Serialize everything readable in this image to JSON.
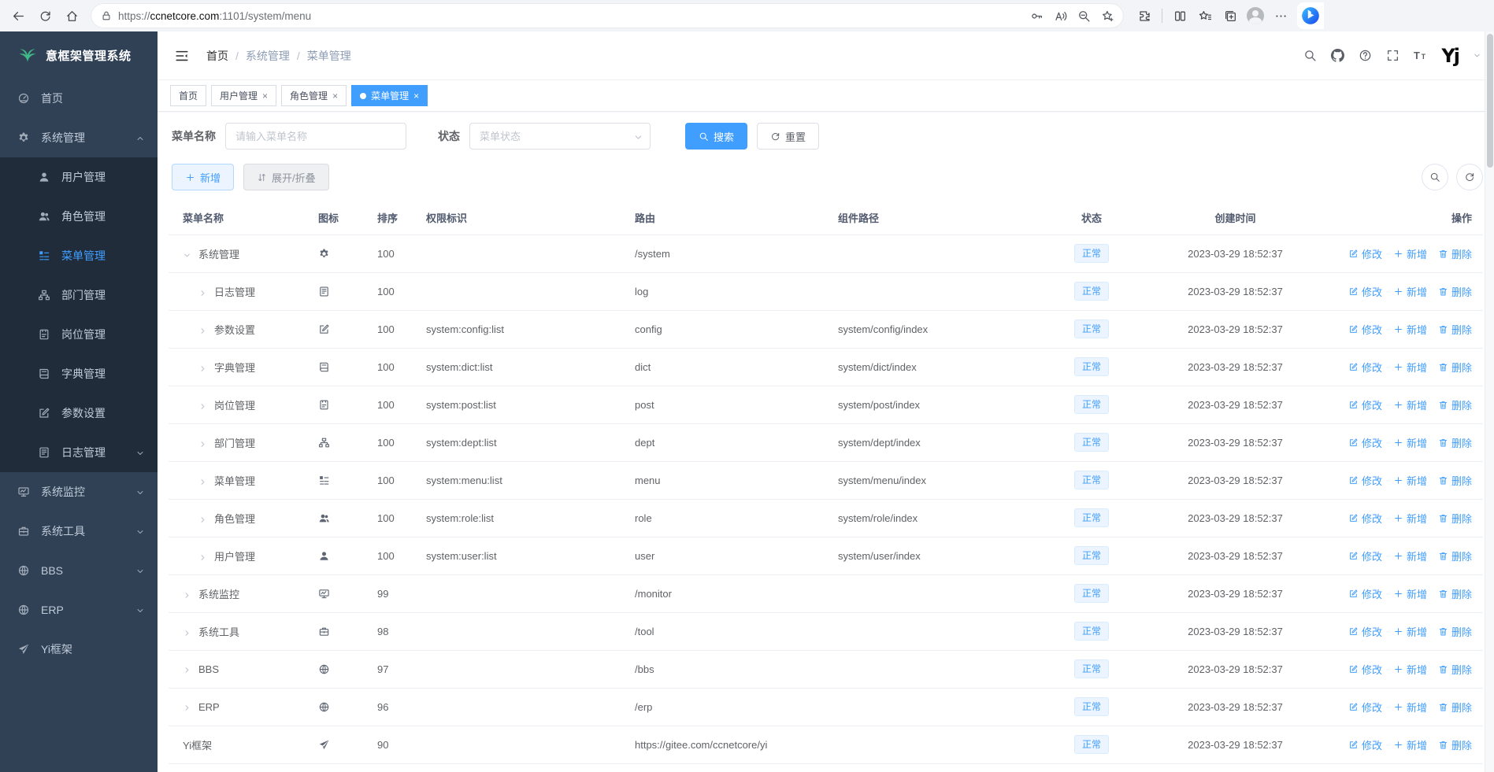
{
  "browser": {
    "url": {
      "scheme": "https://",
      "host": "ccnetcore.com",
      "path": ":1101/system/menu"
    }
  },
  "sidebar": {
    "logo_text": "意框架管理系统",
    "items": [
      {
        "label": "首页",
        "icon": "gauge-icon"
      },
      {
        "label": "系统管理",
        "icon": "gear-icon",
        "chevron": "up",
        "open": true
      },
      {
        "label": "系统监控",
        "icon": "monitor-icon",
        "chevron": "down"
      },
      {
        "label": "系统工具",
        "icon": "toolbox-icon",
        "chevron": "down"
      },
      {
        "label": "BBS",
        "icon": "globe-icon",
        "chevron": "down"
      },
      {
        "label": "ERP",
        "icon": "globe-icon",
        "chevron": "down"
      },
      {
        "label": "Yi框架",
        "icon": "send-icon"
      }
    ],
    "submenu": [
      {
        "label": "用户管理",
        "icon": "user-icon"
      },
      {
        "label": "角色管理",
        "icon": "users-icon"
      },
      {
        "label": "菜单管理",
        "icon": "menu-icon",
        "active": true
      },
      {
        "label": "部门管理",
        "icon": "tree-icon"
      },
      {
        "label": "岗位管理",
        "icon": "badge-icon"
      },
      {
        "label": "字典管理",
        "icon": "book-icon"
      },
      {
        "label": "参数设置",
        "icon": "edit-square-icon"
      },
      {
        "label": "日志管理",
        "icon": "log-icon",
        "chevron": "down"
      }
    ]
  },
  "header": {
    "breadcrumb": [
      "首页",
      "系统管理",
      "菜单管理"
    ],
    "separator": "/"
  },
  "tabs": [
    {
      "label": "首页"
    },
    {
      "label": "用户管理",
      "closable": true
    },
    {
      "label": "角色管理",
      "closable": true
    },
    {
      "label": "菜单管理",
      "closable": true,
      "active": true
    }
  ],
  "filters": {
    "name_label": "菜单名称",
    "name_placeholder": "请输入菜单名称",
    "status_label": "状态",
    "status_placeholder": "菜单状态",
    "search_label": "搜索",
    "reset_label": "重置"
  },
  "toolbar": {
    "add_label": "新增",
    "toggle_label": "展开/折叠"
  },
  "table": {
    "columns": [
      "菜单名称",
      "图标",
      "排序",
      "权限标识",
      "路由",
      "组件路径",
      "状态",
      "创建时间",
      "操作"
    ],
    "actions": {
      "edit": "修改",
      "add": "新增",
      "delete": "删除"
    },
    "rows": [
      {
        "name": "系统管理",
        "icon": "gear-icon",
        "arrow": "down",
        "child": false,
        "sort": "100",
        "perm": "",
        "route": "/system",
        "component": "",
        "status": "正常",
        "created": "2023-03-29 18:52:37"
      },
      {
        "name": "日志管理",
        "icon": "log-icon",
        "arrow": "right",
        "child": true,
        "sort": "100",
        "perm": "",
        "route": "log",
        "component": "",
        "status": "正常",
        "created": "2023-03-29 18:52:37"
      },
      {
        "name": "参数设置",
        "icon": "edit-square-icon",
        "arrow": "right",
        "child": true,
        "sort": "100",
        "perm": "system:config:list",
        "route": "config",
        "component": "system/config/index",
        "status": "正常",
        "created": "2023-03-29 18:52:37"
      },
      {
        "name": "字典管理",
        "icon": "book-icon",
        "arrow": "right",
        "child": true,
        "sort": "100",
        "perm": "system:dict:list",
        "route": "dict",
        "component": "system/dict/index",
        "status": "正常",
        "created": "2023-03-29 18:52:37"
      },
      {
        "name": "岗位管理",
        "icon": "badge-icon",
        "arrow": "right",
        "child": true,
        "sort": "100",
        "perm": "system:post:list",
        "route": "post",
        "component": "system/post/index",
        "status": "正常",
        "created": "2023-03-29 18:52:37"
      },
      {
        "name": "部门管理",
        "icon": "tree-icon",
        "arrow": "right",
        "child": true,
        "sort": "100",
        "perm": "system:dept:list",
        "route": "dept",
        "component": "system/dept/index",
        "status": "正常",
        "created": "2023-03-29 18:52:37"
      },
      {
        "name": "菜单管理",
        "icon": "menu-icon",
        "arrow": "right",
        "child": true,
        "sort": "100",
        "perm": "system:menu:list",
        "route": "menu",
        "component": "system/menu/index",
        "status": "正常",
        "created": "2023-03-29 18:52:37"
      },
      {
        "name": "角色管理",
        "icon": "users-icon",
        "arrow": "right",
        "child": true,
        "sort": "100",
        "perm": "system:role:list",
        "route": "role",
        "component": "system/role/index",
        "status": "正常",
        "created": "2023-03-29 18:52:37"
      },
      {
        "name": "用户管理",
        "icon": "user-icon",
        "arrow": "right",
        "child": true,
        "sort": "100",
        "perm": "system:user:list",
        "route": "user",
        "component": "system/user/index",
        "status": "正常",
        "created": "2023-03-29 18:52:37"
      },
      {
        "name": "系统监控",
        "icon": "monitor-icon",
        "arrow": "right",
        "child": false,
        "sort": "99",
        "perm": "",
        "route": "/monitor",
        "component": "",
        "status": "正常",
        "created": "2023-03-29 18:52:37"
      },
      {
        "name": "系统工具",
        "icon": "toolbox-icon",
        "arrow": "right",
        "child": false,
        "sort": "98",
        "perm": "",
        "route": "/tool",
        "component": "",
        "status": "正常",
        "created": "2023-03-29 18:52:37"
      },
      {
        "name": "BBS",
        "icon": "globe-icon",
        "arrow": "right",
        "child": false,
        "sort": "97",
        "perm": "",
        "route": "/bbs",
        "component": "",
        "status": "正常",
        "created": "2023-03-29 18:52:37"
      },
      {
        "name": "ERP",
        "icon": "globe-icon",
        "arrow": "right",
        "child": false,
        "sort": "96",
        "perm": "",
        "route": "/erp",
        "component": "",
        "status": "正常",
        "created": "2023-03-29 18:52:37"
      },
      {
        "name": "Yi框架",
        "icon": "send-icon",
        "arrow": null,
        "child": false,
        "sort": "90",
        "perm": "",
        "route": "https://gitee.com/ccnetcore/yi",
        "component": "",
        "status": "正常",
        "created": "2023-03-29 18:52:37"
      }
    ]
  }
}
